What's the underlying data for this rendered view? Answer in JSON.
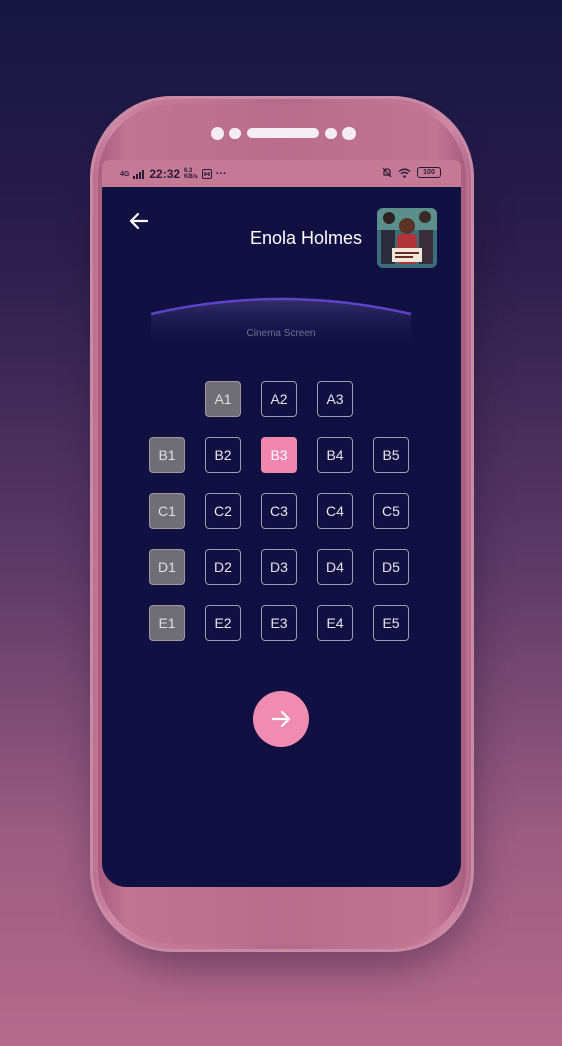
{
  "status_bar": {
    "network": "4G",
    "time": "22:32",
    "speed_value": "6.3",
    "speed_unit": "KB/s",
    "battery": "100"
  },
  "header": {
    "movie_title": "Enola Holmes"
  },
  "cinema": {
    "screen_label": "Cinema Screen"
  },
  "seats": [
    {
      "label": "A1",
      "status": "unavailable"
    },
    {
      "label": "A2",
      "status": "available"
    },
    {
      "label": "A3",
      "status": "available"
    },
    {
      "label": "B1",
      "status": "unavailable"
    },
    {
      "label": "B2",
      "status": "available"
    },
    {
      "label": "B3",
      "status": "selected"
    },
    {
      "label": "B4",
      "status": "available"
    },
    {
      "label": "B5",
      "status": "available"
    },
    {
      "label": "C1",
      "status": "unavailable"
    },
    {
      "label": "C2",
      "status": "available"
    },
    {
      "label": "C3",
      "status": "available"
    },
    {
      "label": "C4",
      "status": "available"
    },
    {
      "label": "C5",
      "status": "available"
    },
    {
      "label": "D1",
      "status": "unavailable"
    },
    {
      "label": "D2",
      "status": "available"
    },
    {
      "label": "D3",
      "status": "available"
    },
    {
      "label": "D4",
      "status": "available"
    },
    {
      "label": "D5",
      "status": "available"
    },
    {
      "label": "E1",
      "status": "unavailable"
    },
    {
      "label": "E2",
      "status": "available"
    },
    {
      "label": "E3",
      "status": "available"
    },
    {
      "label": "E4",
      "status": "available"
    },
    {
      "label": "E5",
      "status": "available"
    }
  ],
  "colors": {
    "background": "#101042",
    "selected": "#f287ad",
    "unavailable": "#6e6e74",
    "screen_arc": "#5a45c8"
  },
  "icons": {
    "back": "arrow-left-icon",
    "next": "arrow-right-icon"
  }
}
